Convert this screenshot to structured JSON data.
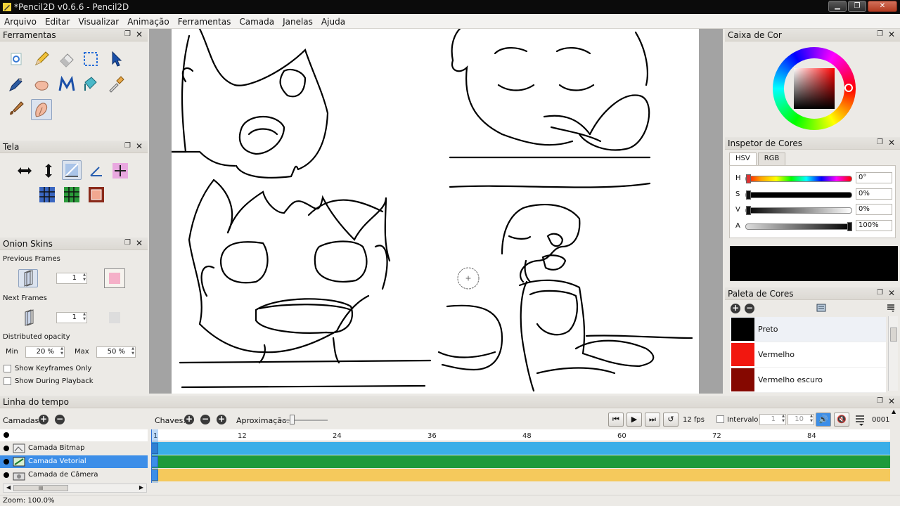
{
  "window": {
    "title": "*Pencil2D v0.6.6 - Pencil2D",
    "buttons": {
      "minimize": "▁",
      "maximize": "❐",
      "close": "✕"
    }
  },
  "menubar": [
    "Arquivo",
    "Editar",
    "Visualizar",
    "Animação",
    "Ferramentas",
    "Camada",
    "Janelas",
    "Ajuda"
  ],
  "panels": {
    "tools": {
      "title": "Ferramentas",
      "items": [
        "clear-icon",
        "pencil-icon",
        "eraser-icon",
        "select-icon",
        "move-icon",
        "pen-icon",
        "hand-icon",
        "polyline-icon",
        "bucket-icon",
        "eyedropper-icon",
        "brush-icon",
        "smudge-icon"
      ]
    },
    "canvas": {
      "title": "Tela",
      "items": [
        "flip-horizontal-icon",
        "flip-vertical-icon",
        "rotate-icon",
        "reset-rotation-icon",
        "center-guide-icon",
        "grid-a-icon",
        "grid-b-icon",
        "overlay-frame-icon"
      ]
    },
    "onion": {
      "title": "Onion Skins",
      "previous_label": "Previous Frames",
      "previous_value": "1",
      "next_label": "Next Frames",
      "next_value": "1",
      "opacity_label": "Distributed opacity",
      "min_label": "Min",
      "min_value": "20 %",
      "max_label": "Max",
      "max_value": "50 %",
      "show_keyframes": "Show Keyframes Only",
      "show_playback": "Show During Playback"
    },
    "colorbox": {
      "title": "Caixa de Cor"
    },
    "inspector": {
      "title": "Inspetor de Cores",
      "tabs": [
        "HSV",
        "RGB"
      ],
      "rows": [
        {
          "label": "H",
          "value": "0°"
        },
        {
          "label": "S",
          "value": "0%"
        },
        {
          "label": "V",
          "value": "0%"
        },
        {
          "label": "A",
          "value": "100%"
        }
      ],
      "current_color": "#000000"
    },
    "palette": {
      "title": "Paleta de Cores",
      "colors": [
        {
          "name": "Preto",
          "hex": "#000000"
        },
        {
          "name": "Vermelho",
          "hex": "#f2170f"
        },
        {
          "name": "Vermelho escuro",
          "hex": "#850800"
        }
      ]
    }
  },
  "timeline": {
    "title": "Linha do tempo",
    "layers_label": "Camadas:",
    "keys_label": "Chaves:",
    "zoom_label": "Aproximação:",
    "fps": "12 fps",
    "interval_label": "Intervalo",
    "range_start": "1",
    "range_end": "10",
    "frame_counter": "0001",
    "ruler": [
      "1",
      "12",
      "24",
      "36",
      "48",
      "60",
      "72",
      "84"
    ],
    "layers": [
      {
        "name": "Camada Bitmap",
        "color": "#3aaee8"
      },
      {
        "name": "Camada Vetorial",
        "color": "#1e9a3a"
      },
      {
        "name": "Camada de Câmera",
        "color": "#f5c95c"
      }
    ],
    "selected_layer": 1,
    "scrollbar_grip": "III"
  },
  "status": {
    "zoom": "Zoom: 100.0%"
  }
}
